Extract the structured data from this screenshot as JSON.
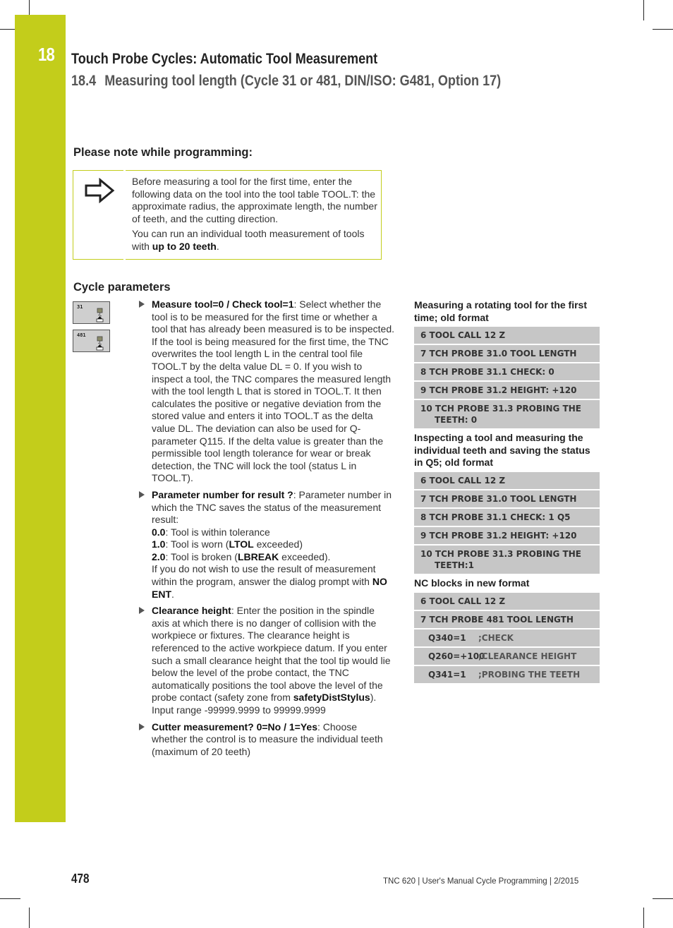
{
  "header": {
    "chapter_number": "18",
    "chapter_title": "Touch Probe Cycles: Automatic Tool Measurement",
    "section_number": "18.4",
    "section_title": "Measuring tool length (Cycle 31 or 481, DIN/ISO: G481, Option 17)"
  },
  "note": {
    "heading": "Please note while programming:",
    "icon": "arrow-right-icon",
    "paragraph1": "Before measuring a tool for the first time, enter the following data on the tool into the tool table TOOL.T: the approximate radius, the approximate length, the number of teeth, and the cutting direction.",
    "paragraph2_prefix": "You can run an individual tooth measurement of tools with ",
    "paragraph2_bold": "up to 20 teeth",
    "paragraph2_suffix": "."
  },
  "cycle_parameters": {
    "heading": "Cycle parameters",
    "icons": [
      {
        "label": "31",
        "icon": "tool-probe-icon"
      },
      {
        "label": "481",
        "icon": "tool-probe-icon"
      }
    ],
    "params": [
      {
        "name": "Measure tool=0 / Check tool=1",
        "text": ": Select whether the tool is to be measured for the first time or whether a tool that has already been measured is to be inspected. If the tool is being measured for the first time, the TNC overwrites the tool length L in the central tool file TOOL.T by the delta value DL = 0. If you wish to inspect a tool, the TNC compares the measured length with the tool length L that is stored in TOOL.T. It then calculates the positive or negative deviation from the stored value and enters it into TOOL.T as the delta value DL. The deviation can also be used for Q-parameter Q115. If the delta value is greater than the permissible tool length tolerance for wear or break detection, the TNC will lock the tool (status L in TOOL.T)."
      },
      {
        "name": "Parameter number for result ?",
        "text": ": Parameter number in which the TNC saves the status of the measurement result:",
        "results": [
          {
            "code": "0.0",
            "text_before": ": Tool is within tolerance",
            "kw": "",
            "text_after": ""
          },
          {
            "code": "1.0",
            "text_before": ": Tool is worn (",
            "kw": "LTOL",
            "text_after": " exceeded)"
          },
          {
            "code": "2.0",
            "text_before": ": Tool is broken (",
            "kw": "LBREAK",
            "text_after": " exceeded)."
          }
        ],
        "footer_text": "If you do not wish to use the result of measurement within the program, answer the dialog prompt with ",
        "footer_kw": "NO ENT",
        "footer_end": "."
      },
      {
        "name": "Clearance height",
        "text": ": Enter the position in the spindle axis at which there is no danger of collision with the workpiece or fixtures. The clearance height is referenced to the active workpiece datum. If you enter such a small clearance height that the tool tip would lie below the level of the probe contact, the TNC automatically positions the tool above the level of the probe contact (safety zone from ",
        "kw": "safetyDistStylus",
        "text_end": "). Input range -99999.9999 to 99999.9999"
      },
      {
        "name": "Cutter measurement? 0=No / 1=Yes",
        "text": ": Choose whether the control is to measure the individual teeth (maximum of 20 teeth)"
      }
    ]
  },
  "examples": [
    {
      "heading": "Measuring a rotating tool for the first time; old format",
      "rows": [
        {
          "main": "6 TOOL CALL 12 Z"
        },
        {
          "main": "7 TCH PROBE 31.0 TOOL LENGTH"
        },
        {
          "main": "8 TCH PROBE 31.1 CHECK: 0"
        },
        {
          "main": "9 TCH PROBE 31.2 HEIGHT: +120"
        },
        {
          "main": "10 TCH PROBE 31.3 PROBING THE",
          "cont": "TEETH: 0"
        }
      ]
    },
    {
      "heading": "Inspecting a tool and measuring the individual teeth and saving the status in Q5; old format",
      "rows": [
        {
          "main": "6 TOOL CALL 12 Z"
        },
        {
          "main": "7 TCH PROBE 31.0 TOOL LENGTH"
        },
        {
          "main": "8 TCH PROBE 31.1 CHECK: 1 Q5"
        },
        {
          "main": "9 TCH PROBE 31.2 HEIGHT: +120"
        },
        {
          "main": "10 TCH PROBE 31.3 PROBING THE",
          "cont": "TEETH:1"
        }
      ]
    },
    {
      "heading": "NC blocks in new format",
      "rows": [
        {
          "main": "6 TOOL CALL 12 Z"
        },
        {
          "main": "7 TCH PROBE 481 TOOL LENGTH"
        },
        {
          "param": "Q340=1",
          "comment": ";CHECK"
        },
        {
          "param": "Q260=+100",
          "comment": ";CLEARANCE HEIGHT"
        },
        {
          "param": "Q341=1",
          "comment": ";PROBING THE TEETH"
        }
      ]
    }
  ],
  "footer": {
    "page_number": "478",
    "text": "TNC 620 | User's Manual Cycle Programming | 2/2015"
  },
  "colors": {
    "accent": "#c3cd1b",
    "code_bg": "#c6c6c6"
  }
}
